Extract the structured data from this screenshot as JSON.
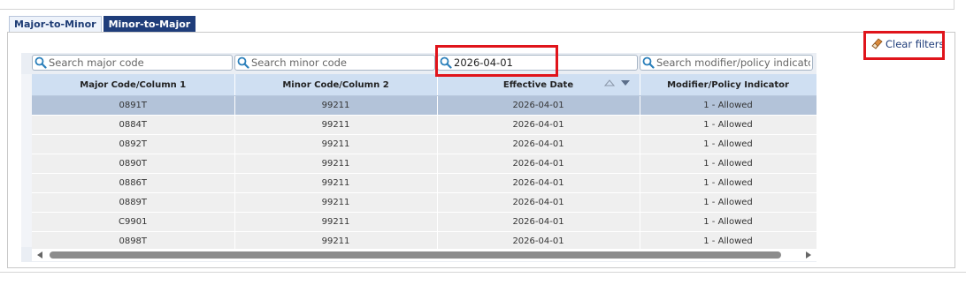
{
  "tabs": [
    {
      "label": "Major-to-Minor",
      "active": false
    },
    {
      "label": "Minor-to-Major",
      "active": true
    }
  ],
  "clear_filters_label": "Clear filters",
  "filters": {
    "major_placeholder": "Search major code",
    "minor_placeholder": "Search minor code",
    "date_value": "2026-04-01",
    "modifier_placeholder": "Search modifier/policy indicator"
  },
  "columns": [
    "Major Code/Column 1",
    "Minor Code/Column 2",
    "Effective Date",
    "Modifier/Policy Indicator"
  ],
  "rows": [
    {
      "major": "0891T",
      "minor": "99211",
      "date": "2026-04-01",
      "modifier": "1 - Allowed",
      "selected": true
    },
    {
      "major": "0884T",
      "minor": "99211",
      "date": "2026-04-01",
      "modifier": "1 - Allowed"
    },
    {
      "major": "0892T",
      "minor": "99211",
      "date": "2026-04-01",
      "modifier": "1 - Allowed"
    },
    {
      "major": "0890T",
      "minor": "99211",
      "date": "2026-04-01",
      "modifier": "1 - Allowed"
    },
    {
      "major": "0886T",
      "minor": "99211",
      "date": "2026-04-01",
      "modifier": "1 - Allowed"
    },
    {
      "major": "0889T",
      "minor": "99211",
      "date": "2026-04-01",
      "modifier": "1 - Allowed"
    },
    {
      "major": "C9901",
      "minor": "99211",
      "date": "2026-04-01",
      "modifier": "1 - Allowed"
    },
    {
      "major": "0898T",
      "minor": "99211",
      "date": "2026-04-01",
      "modifier": "1 - Allowed"
    }
  ],
  "colors": {
    "tab_active_bg": "#1f3d7a",
    "header_bg": "#cfdff2",
    "selected_row_bg": "#b3c3d9",
    "highlight_red": "#e0141b"
  }
}
